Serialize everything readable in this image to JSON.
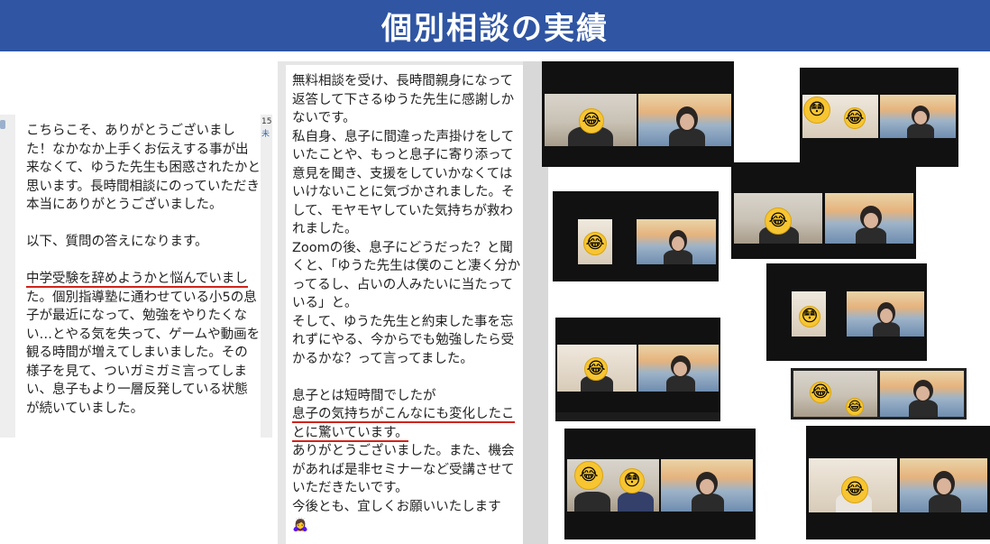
{
  "header": {
    "title": "個別相談の実績",
    "bg_color": "#2f55a3"
  },
  "left_chat": {
    "side_meta": [
      "15",
      "未"
    ],
    "paragraph1": "こちらこそ、ありがとうございました！なかなか上手くお伝えする事が出来なくて、ゆうた先生も困惑されたかと思います。長時間相談にのっていただき本当にありがとうございました。",
    "paragraph2": "以下、質問の答えになります。",
    "underlined": "中学受験を辞めようかと悩んでいまし",
    "paragraph3_rest": "た。個別指導塾に通わせている小5の息子が最近になって、勉強をやりたくない…とやる気を失って、ゲームや動画を観る時間が増えてしまいました。その様子を見て、ついガミガミ言ってしまい、息子もより一層反発している状態が続いていました。"
  },
  "mid_chat": {
    "paragraph1": "無料相談を受け、長時間親身になって返答して下さるゆうた先生に感謝しかないです。\n私自身、息子に間違った声掛けをしていたことや、もっと息子に寄り添って意見を聞き、支援をしていかなくてはいけないことに気づかされました。そして、モヤモヤしていた気持ちが救われました。\nZoomの後、息子にどうだった？と聞くと、「ゆうた先生は僕のこと凄く分かってるし、占いの人みたいに当たっている」と。\nそして、ゆうた先生と約束した事を忘れずにやる、今からでも勉強したら受かるかな？って言ってました。",
    "paragraph2": "息子とは短時間でしたが",
    "underlined": "息子の気持ちがこんなにも変化したことに驚いています。",
    "paragraph3": "ありがとうございました。また、機会があれば是非セミナーなど受講させていただきたいです。\n今後とも、宜しくお願いいたします",
    "trailing_emoji": "🙇‍♀️"
  },
  "zoom_screens": {
    "emoji_laugh": "😂",
    "emoji_wow": "😳",
    "accent_red": "#d0241b"
  }
}
